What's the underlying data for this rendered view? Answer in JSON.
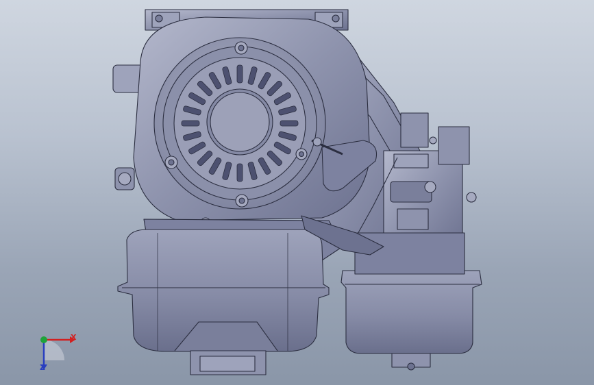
{
  "viewport": {
    "background_top": "#cfd6e0",
    "background_bottom": "#8a96a8"
  },
  "model": {
    "body_color": "#8e93ad",
    "highlight_color": "#b4b8cc",
    "shadow_color": "#5e6380",
    "edge_color": "#2b2e40"
  },
  "triad": {
    "x_label": "X",
    "z_label": "Z",
    "x_color": "#d22020",
    "y_color": "#1fa33a",
    "z_color": "#2a3fbf"
  }
}
